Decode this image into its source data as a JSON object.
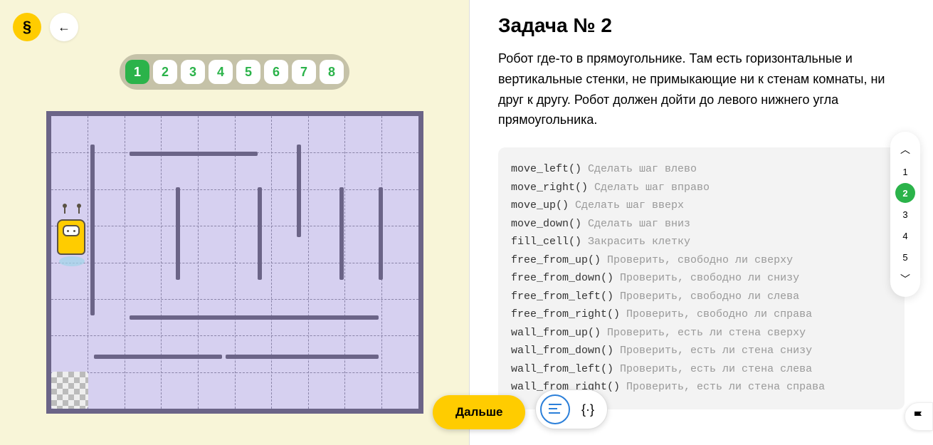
{
  "logo_glyph": "§",
  "steps": {
    "items": [
      "1",
      "2",
      "3",
      "4",
      "5",
      "6",
      "7",
      "8"
    ],
    "active": 0
  },
  "task": {
    "title": "Задача № 2",
    "description": "Робот где-то в прямоугольнике. Там есть горизонтальные и вертикальные стенки, не примыкающие ни к стенам комнаты, ни друг к другу. Робот должен дойти до левого нижнего угла прямоугольника."
  },
  "commands": [
    {
      "name": "move_left()",
      "desc": "Сделать шаг влево"
    },
    {
      "name": "move_right()",
      "desc": "Сделать шаг вправо"
    },
    {
      "name": "move_up()",
      "desc": "Сделать шаг вверх"
    },
    {
      "name": "move_down()",
      "desc": "Сделать шаг вниз"
    },
    {
      "name": "fill_cell()",
      "desc": "Закрасить клетку"
    },
    {
      "name": "free_from_up()",
      "desc": "Проверить, свободно ли сверху"
    },
    {
      "name": "free_from_down()",
      "desc": "Проверить, свободно ли снизу"
    },
    {
      "name": "free_from_left()",
      "desc": "Проверить, свободно ли слева"
    },
    {
      "name": "free_from_right()",
      "desc": "Проверить, свободно ли справа"
    },
    {
      "name": "wall_from_up()",
      "desc": "Проверить, есть ли стена сверху"
    },
    {
      "name": "wall_from_down()",
      "desc": "Проверить, есть ли стена снизу"
    },
    {
      "name": "wall_from_left()",
      "desc": "Проверить, есть ли стена слева"
    },
    {
      "name": "wall_from_right()",
      "desc": "Проверить, есть ли стена справа"
    }
  ],
  "next_button": "Дальше",
  "side_nav": {
    "items": [
      "1",
      "2",
      "3",
      "4",
      "5"
    ],
    "active": 1
  }
}
